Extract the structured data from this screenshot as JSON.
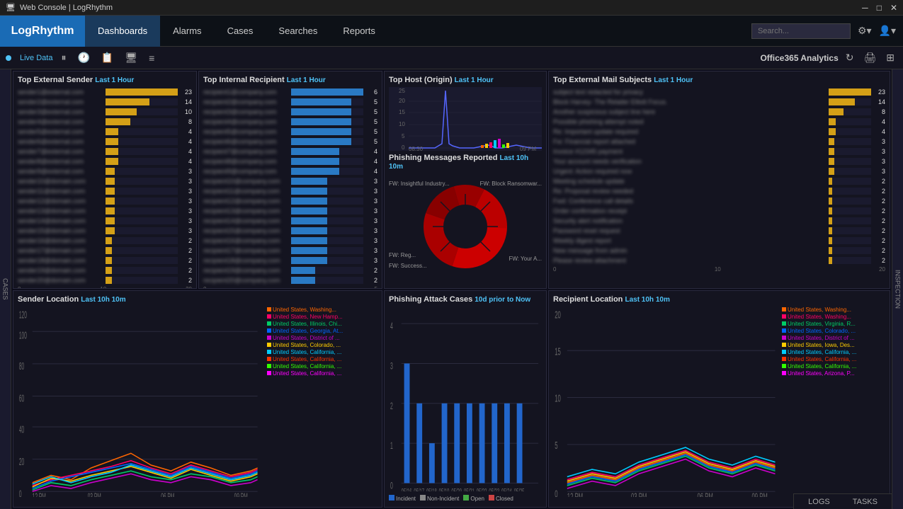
{
  "titleBar": {
    "title": "Web Console | LogRhythm",
    "minimize": "─",
    "maximize": "□",
    "close": "✕"
  },
  "nav": {
    "logo": "LogRhythm",
    "items": [
      "Dashboards",
      "Alarms",
      "Cases",
      "Searches",
      "Reports"
    ],
    "activeItem": "Dashboards",
    "searchPlaceholder": "Search...",
    "settingsIcon": "⚙",
    "userIcon": "👤"
  },
  "toolbar": {
    "liveData": "Live Data",
    "dashboardName": "Office365 Analytics",
    "icons": [
      "⏸",
      "🕐",
      "📋",
      "🖥",
      "≡"
    ],
    "refreshIcon": "↻",
    "printIcon": "🖨",
    "filterIcon": "⊞"
  },
  "panels": {
    "topExternalSender": {
      "title": "Top External Sender",
      "subtitle": "Last 1 Hour",
      "maxValue": 20,
      "items": [
        {
          "label": "sender1@external.com",
          "value": 23,
          "maxBar": 23
        },
        {
          "label": "sender2@external.com",
          "value": 14,
          "maxBar": 14
        },
        {
          "label": "sender3@external.com",
          "value": 10,
          "maxBar": 10
        },
        {
          "label": "sender4@external.com",
          "value": 8,
          "maxBar": 8
        },
        {
          "label": "sender5@external.com",
          "value": 4,
          "maxBar": 4
        },
        {
          "label": "sender6@external.com",
          "value": 4,
          "maxBar": 4
        },
        {
          "label": "sender7@external.com",
          "value": 4,
          "maxBar": 4
        },
        {
          "label": "sender8@external.com",
          "value": 4,
          "maxBar": 4
        },
        {
          "label": "sender9@external.com",
          "value": 3,
          "maxBar": 3
        },
        {
          "label": "sender10@domain.com",
          "value": 3,
          "maxBar": 3
        },
        {
          "label": "sender11@domain.com",
          "value": 3,
          "maxBar": 3
        },
        {
          "label": "sender12@domain.com",
          "value": 3,
          "maxBar": 3
        },
        {
          "label": "sender13@domain.com",
          "value": 3,
          "maxBar": 3
        },
        {
          "label": "sender14@domain.com",
          "value": 3,
          "maxBar": 3
        },
        {
          "label": "sender15@domain.com",
          "value": 3,
          "maxBar": 3
        },
        {
          "label": "sender16@domain.com",
          "value": 2,
          "maxBar": 2
        },
        {
          "label": "sender17@domain.com",
          "value": 2,
          "maxBar": 2
        },
        {
          "label": "sender18@domain.com",
          "value": 2,
          "maxBar": 2
        },
        {
          "label": "sender19@domain.com",
          "value": 2,
          "maxBar": 2
        },
        {
          "label": "sender20@domain.com",
          "value": 2,
          "maxBar": 2
        }
      ],
      "axisLabels": [
        "0",
        "10",
        "20"
      ]
    },
    "topInternalRecipient": {
      "title": "Top Internal Recipient",
      "subtitle": "Last 1 Hour",
      "items": [
        {
          "label": "recipient1@company.com",
          "value": 6
        },
        {
          "label": "recipient2@company.com",
          "value": 5
        },
        {
          "label": "recipient3@company.com",
          "value": 5
        },
        {
          "label": "recipient4@company.com",
          "value": 5
        },
        {
          "label": "recipient5@company.com",
          "value": 5
        },
        {
          "label": "recipient6@company.com",
          "value": 5
        },
        {
          "label": "recipient7@company.com",
          "value": 4
        },
        {
          "label": "recipient8@company.com",
          "value": 4
        },
        {
          "label": "recipient9@company.com",
          "value": 4
        },
        {
          "label": "recipient10@company.com",
          "value": 3
        },
        {
          "label": "recipient11@company.com",
          "value": 3
        },
        {
          "label": "recipient12@company.com",
          "value": 3
        },
        {
          "label": "recipient13@company.com",
          "value": 3
        },
        {
          "label": "recipient14@company.com",
          "value": 3
        },
        {
          "label": "recipient15@company.com",
          "value": 3
        },
        {
          "label": "recipient16@company.com",
          "value": 3
        },
        {
          "label": "recipient17@company.com",
          "value": 3
        },
        {
          "label": "recipient18@company.com",
          "value": 3
        },
        {
          "label": "recipient19@company.com",
          "value": 2
        },
        {
          "label": "recipient20@company.com",
          "value": 2
        }
      ],
      "axisLabels": [
        "0",
        "5"
      ]
    },
    "topHost": {
      "title": "Top Host (Origin)",
      "subtitle": "Last 1 Hour",
      "maxY": 25,
      "timeLabels": [
        "08:30",
        "09 PM"
      ],
      "yLabels": [
        "0",
        "5",
        "10",
        "15",
        "20",
        "25"
      ]
    },
    "topMailSubjects": {
      "title": "Top External Mail Subjects",
      "subtitle": "Last 1 Hour",
      "items": [
        {
          "label": "subject text redacted for privacy",
          "value": 23
        },
        {
          "label": "Block Harvey- The Retailer Elliott Focus.",
          "value": 14
        },
        {
          "label": "Another suspicious subject line here",
          "value": 8
        },
        {
          "label": "Possible phishing attempt noted",
          "value": 4
        },
        {
          "label": "Re: Important update required",
          "value": 4
        },
        {
          "label": "Fw: Financial report attached",
          "value": 3
        },
        {
          "label": "Invoice #12345 payment",
          "value": 3
        },
        {
          "label": "Your account needs verification",
          "value": 3
        },
        {
          "label": "Urgent: Action required now",
          "value": 3
        },
        {
          "label": "Meeting schedule update",
          "value": 2
        },
        {
          "label": "Re: Proposal review needed",
          "value": 2
        },
        {
          "label": "Fwd: Conference call details",
          "value": 2
        },
        {
          "label": "Order confirmation receipt",
          "value": 2
        },
        {
          "label": "Security alert notification",
          "value": 2
        },
        {
          "label": "Password reset request",
          "value": 2
        },
        {
          "label": "Weekly digest report",
          "value": 2
        },
        {
          "label": "New message from admin",
          "value": 2
        },
        {
          "label": "Please review attachment",
          "value": 2
        }
      ],
      "axisLabels": [
        "0",
        "10",
        "20"
      ]
    },
    "phishingMessages": {
      "title": "Phishing Messages Reported",
      "subtitle": "Last 10h 10m",
      "segments": [
        {
          "label": "FW: Insightful Industry...",
          "value": 30,
          "color": "#cc0000"
        },
        {
          "label": "FW: Block Ransomwar...",
          "value": 25,
          "color": "#aa0000"
        },
        {
          "label": "FW: Reg...",
          "value": 15,
          "color": "#880000"
        },
        {
          "label": "FW: Success...",
          "value": 12,
          "color": "#990000"
        },
        {
          "label": "FW: Your A...",
          "value": 18,
          "color": "#bb0000"
        }
      ]
    },
    "senderLocation": {
      "title": "Sender Location",
      "subtitle": "Last 10h 10m",
      "yLabels": [
        "0",
        "20",
        "40",
        "60",
        "80",
        "100",
        "120"
      ],
      "xLabels": [
        "12 PM",
        "03 PM",
        "06 PM",
        "09 PM"
      ],
      "legend": [
        {
          "label": "United States, Washing...",
          "color": "#ff6600"
        },
        {
          "label": "United States, New Hamp...",
          "color": "#ff0066"
        },
        {
          "label": "United States, Illinois, Chi...",
          "color": "#00cc66"
        },
        {
          "label": "United States, Georgia, At...",
          "color": "#0066ff"
        },
        {
          "label": "United States, District of ...",
          "color": "#cc00cc"
        },
        {
          "label": "United States, Colorado, ...",
          "color": "#ffcc00"
        },
        {
          "label": "United States, California, ...",
          "color": "#00ccff"
        },
        {
          "label": "United States, California, ...",
          "color": "#ff3300"
        },
        {
          "label": "United States, California, ...",
          "color": "#33ff00"
        },
        {
          "label": "United States, California, ...",
          "color": "#ff00ff"
        }
      ]
    },
    "phishingCases": {
      "title": "Phishing Attack Cases",
      "subtitle": "10d prior to Now",
      "yLabels": [
        "0",
        "1",
        "2",
        "3",
        "4"
      ],
      "xLabels": [
        "05/16",
        "05/17",
        "05/18",
        "05/19",
        "05/20",
        "05/21",
        "05/22",
        "05/23",
        "05/24",
        "05/25"
      ],
      "legend": [
        "Incident",
        "Non-Incident",
        "Open",
        "Closed"
      ],
      "legendColors": [
        "#2266cc",
        "#888888",
        "#44aa44",
        "#cc4444"
      ]
    },
    "recipientLocation": {
      "title": "Recipient Location",
      "subtitle": "Last 10h 10m",
      "yLabels": [
        "0",
        "5",
        "10",
        "15",
        "20"
      ],
      "xLabels": [
        "12 PM",
        "03 PM",
        "06 PM",
        "09 PM"
      ],
      "legend": [
        {
          "label": "United States, Washing...",
          "color": "#ff6600"
        },
        {
          "label": "United States, Washing...",
          "color": "#ff0066"
        },
        {
          "label": "United States, Virginia, R...",
          "color": "#00cc66"
        },
        {
          "label": "United States, Colorado, ...",
          "color": "#0066ff"
        },
        {
          "label": "United States, District of ...",
          "color": "#cc00cc"
        },
        {
          "label": "United States, Iowa, Des...",
          "color": "#ffcc00"
        },
        {
          "label": "United States, California, ...",
          "color": "#00ccff"
        },
        {
          "label": "United States, California, ...",
          "color": "#ff3300"
        },
        {
          "label": "United States, California, ...",
          "color": "#33ff00"
        },
        {
          "label": "United States, Arizona, P...",
          "color": "#ff00ff"
        }
      ]
    }
  },
  "bottomBar": {
    "tabs": [
      "LOGS",
      "TASKS"
    ]
  },
  "sideRight": {
    "label": "INSPECTION"
  }
}
